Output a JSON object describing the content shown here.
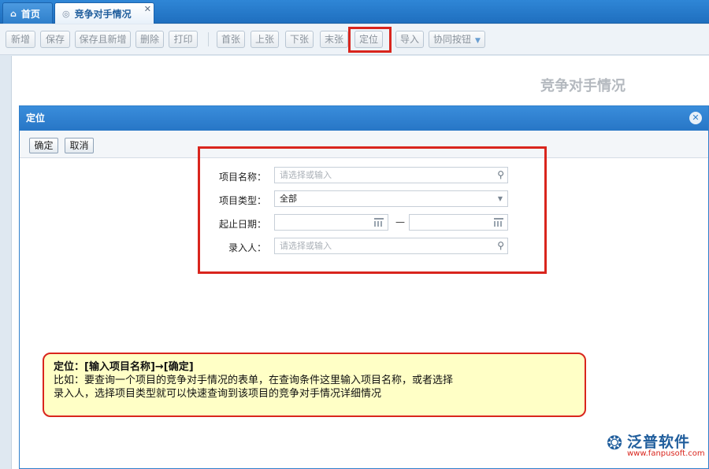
{
  "tabs": [
    {
      "label": "首页",
      "icon": "home-icon"
    },
    {
      "label": "竞争对手情况",
      "icon": "page-icon"
    }
  ],
  "toolbar": {
    "buttons": [
      "新增",
      "保存",
      "保存且新增",
      "删除",
      "打印",
      "首张",
      "上张",
      "下张",
      "末张",
      "定位",
      "导入",
      "协同按钮"
    ]
  },
  "page": {
    "heading": "竞争对手情况"
  },
  "dialog": {
    "title": "定位",
    "confirm_label": "确定",
    "cancel_label": "取消",
    "form": {
      "project_name_label": "项目名称：",
      "project_name_placeholder": "请选择或输入",
      "project_type_label": "项目类型：",
      "project_type_value": "全部",
      "date_label": "起止日期：",
      "date_separator": "—",
      "date_start": "",
      "date_end": "",
      "entered_by_label": "录入人：",
      "entered_by_placeholder": "请选择或输入"
    }
  },
  "note": {
    "line1": "定位：[输入项目名称]→[确定]",
    "line2": "比如：要查询一个项目的竞争对手情况的表单，在查询条件这里输入项目名称，或者选择",
    "line3": "录入人，选择项目类型就可以快速查询到该项目的竞争对手情况详细情况"
  },
  "logo": {
    "name": "泛普软件",
    "url": "www.fanpusoft.com"
  },
  "colors": {
    "accent": "#2f7fcb",
    "highlight": "#d9251d",
    "note_bg": "#ffffc6"
  }
}
